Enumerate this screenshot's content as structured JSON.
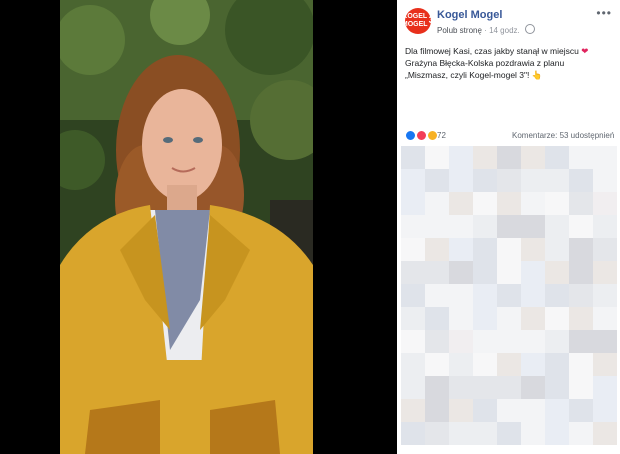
{
  "post": {
    "page_name": "Kogel Mogel",
    "like_page": "Polub stronę",
    "dot": "·",
    "time": "14 godz.",
    "more": "•••",
    "logo_line1": "KOGEL",
    "logo_line2": "MOGEL",
    "logo_num": "3",
    "caption_line1": "Dla filmowej Kasi, czas jakby stanął w miejscu",
    "caption_line2": "Grażyna Błęcka-Kolska pozdrawia z planu",
    "caption_line3": "„Miszmasz, czyli Kogel-mogel 3\"!",
    "heart_glyph": "❤",
    "thumb_glyph": "👆",
    "reactions_count": "72",
    "comments": "Komentarze: 5",
    "shares": "3 udostępnień"
  },
  "colors": {
    "link": "#385898",
    "coat": "#d9a52c",
    "background": "#000000"
  },
  "icons": [
    "globe-icon",
    "heart-icon",
    "pointing-hand-icon",
    "like-reaction-icon",
    "love-reaction-icon",
    "wow-reaction-icon",
    "more-icon"
  ]
}
